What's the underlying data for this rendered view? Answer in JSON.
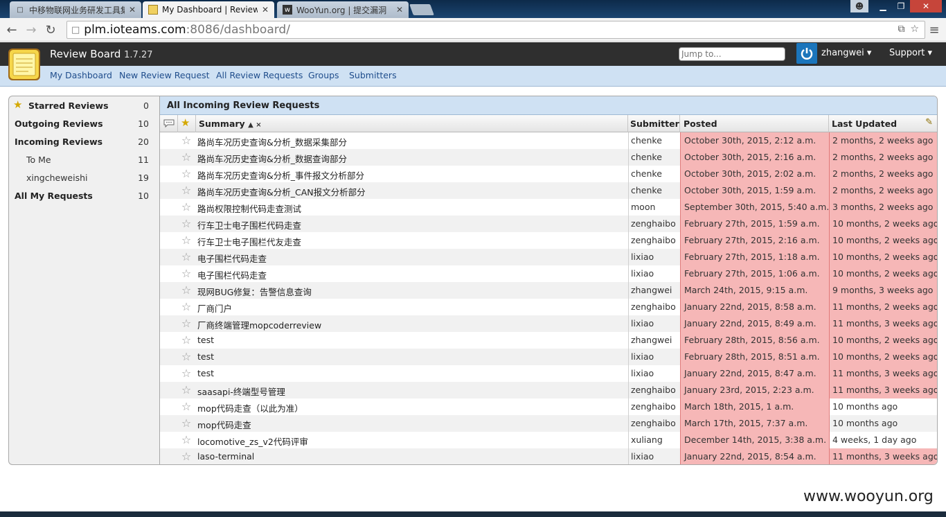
{
  "browser": {
    "tabs": [
      {
        "label": "中移物联网业务研发工具集",
        "active": false
      },
      {
        "label": "My Dashboard | Review",
        "active": true
      },
      {
        "label": "WooYun.org | 提交漏洞",
        "active": false
      }
    ],
    "url_host": "plm.ioteams.com",
    "url_path": ":8086/dashboard/"
  },
  "header": {
    "app_name": "Review Board",
    "version": "1.7.27",
    "jump_placeholder": "Jump to...",
    "user": "zhangwei ▾",
    "support": "Support ▾"
  },
  "subnav": {
    "items": [
      "My Dashboard",
      "New Review Request",
      "All Review Requests",
      "Groups",
      "Submitters"
    ]
  },
  "sidebar": {
    "items": [
      {
        "label": "Starred Reviews",
        "count": "0"
      },
      {
        "label": "Outgoing Reviews",
        "count": "10"
      },
      {
        "label": "Incoming Reviews",
        "count": "20"
      },
      {
        "label": "To Me",
        "count": "11"
      },
      {
        "label": "xingcheweishi",
        "count": "19"
      },
      {
        "label": "All My Requests",
        "count": "10"
      }
    ]
  },
  "main": {
    "title": "All Incoming Review Requests",
    "columns": {
      "summary": "Summary",
      "sort_marks": "▲ ×",
      "submitter": "Submitter",
      "posted": "Posted",
      "updated": "Last Updated"
    },
    "rows": [
      {
        "summary": "路尚车况历史查询&分析_数据采集部分",
        "submitter": "chenke",
        "posted": "October 30th, 2015, 2:12 a.m.",
        "updated": "2 months, 2 weeks ago"
      },
      {
        "summary": "路尚车况历史查询&分析_数据查询部分",
        "submitter": "chenke",
        "posted": "October 30th, 2015, 2:16 a.m.",
        "updated": "2 months, 2 weeks ago"
      },
      {
        "summary": "路尚车况历史查询&分析_事件报文分析部分",
        "submitter": "chenke",
        "posted": "October 30th, 2015, 2:02 a.m.",
        "updated": "2 months, 2 weeks ago"
      },
      {
        "summary": "路尚车况历史查询&分析_CAN报文分析部分",
        "submitter": "chenke",
        "posted": "October 30th, 2015, 1:59 a.m.",
        "updated": "2 months, 2 weeks ago"
      },
      {
        "summary": "路尚权限控制代码走查测试",
        "submitter": "moon",
        "posted": "September 30th, 2015, 5:40 a.m.",
        "updated": "3 months, 2 weeks ago"
      },
      {
        "summary": "行车卫士电子围栏代码走查",
        "submitter": "zenghaibo",
        "posted": "February 27th, 2015, 1:59 a.m.",
        "updated": "10 months, 2 weeks ago"
      },
      {
        "summary": "行车卫士电子围栏代友走查",
        "submitter": "zenghaibo",
        "posted": "February 27th, 2015, 2:16 a.m.",
        "updated": "10 months, 2 weeks ago"
      },
      {
        "summary": "电子围栏代码走查",
        "submitter": "lixiao",
        "posted": "February 27th, 2015, 1:18 a.m.",
        "updated": "10 months, 2 weeks ago"
      },
      {
        "summary": "电子围栏代码走查",
        "submitter": "lixiao",
        "posted": "February 27th, 2015, 1:06 a.m.",
        "updated": "10 months, 2 weeks ago"
      },
      {
        "summary": "现网BUG修复：告警信息查询",
        "submitter": "zhangwei",
        "posted": "March 24th, 2015, 9:15 a.m.",
        "updated": "9 months, 3 weeks ago"
      },
      {
        "summary": "厂商门户",
        "submitter": "zenghaibo",
        "posted": "January 22nd, 2015, 8:58 a.m.",
        "updated": "11 months, 2 weeks ago"
      },
      {
        "summary": "厂商终端管理mopcoderreview",
        "submitter": "lixiao",
        "posted": "January 22nd, 2015, 8:49 a.m.",
        "updated": "11 months, 3 weeks ago"
      },
      {
        "summary": "test",
        "submitter": "zhangwei",
        "posted": "February 28th, 2015, 8:56 a.m.",
        "updated": "10 months, 2 weeks ago"
      },
      {
        "summary": "test",
        "submitter": "lixiao",
        "posted": "February 28th, 2015, 8:51 a.m.",
        "updated": "10 months, 2 weeks ago"
      },
      {
        "summary": "test",
        "submitter": "lixiao",
        "posted": "January 22nd, 2015, 8:47 a.m.",
        "updated": "11 months, 3 weeks ago"
      },
      {
        "summary": "saasapi-终端型号管理",
        "submitter": "zenghaibo",
        "posted": "January 23rd, 2015, 2:23 a.m.",
        "updated": "11 months, 3 weeks ago"
      },
      {
        "summary": "mop代码走查（以此为准）",
        "submitter": "zenghaibo",
        "posted": "March 18th, 2015, 1 a.m.",
        "updated": "10 months ago",
        "updated_old": false
      },
      {
        "summary": "mop代码走查",
        "submitter": "zenghaibo",
        "posted": "March 17th, 2015, 7:37 a.m.",
        "updated": "10 months ago",
        "updated_old": false
      },
      {
        "summary": "locomotive_zs_v2代码评审",
        "submitter": "xuliang",
        "posted": "December 14th, 2015, 3:38 a.m.",
        "updated": "4 weeks, 1 day ago",
        "updated_old": false
      },
      {
        "summary": "laso-terminal",
        "submitter": "lixiao",
        "posted": "January 22nd, 2015, 8:54 a.m.",
        "updated": "11 months, 3 weeks ago"
      }
    ]
  },
  "watermark": "www.wooyun.org",
  "colors": {
    "accent": "#1b75bb",
    "header_bg": "#2f2f2f",
    "subnav_bg": "#cfe1f3",
    "old_bg": "#f6b7b7"
  }
}
